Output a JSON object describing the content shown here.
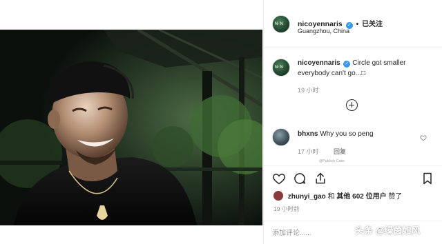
{
  "post": {
    "image_description_icon": "photo-icon"
  },
  "header": {
    "username": "nicoyennaris",
    "verified_icon": "verified-badge-icon",
    "dot": "•",
    "follow_status": "已关注",
    "location": "Guangzhou, China"
  },
  "caption": {
    "username": "nicoyennaris",
    "text": "Circle got smaller everybody can't go...",
    "glyph": "□",
    "time": "19 小时"
  },
  "load_more_icon": "plus-circle-icon",
  "comments": [
    {
      "username": "bhxns",
      "text": "Why you so peng",
      "time": "17 小时",
      "reply_label": "回复"
    }
  ],
  "tiny_watermark": "@Publish Cake",
  "actions": {
    "like_icon": "heart-icon",
    "comment_icon": "comment-icon",
    "share_icon": "share-icon",
    "save_icon": "bookmark-icon"
  },
  "likes": {
    "liker": "zhunyi_gao",
    "conj": "和",
    "others_prefix": "其他",
    "count": "602",
    "others_suffix": "位用户",
    "liked": "赞了"
  },
  "post_time": "19 小时前",
  "add_comment": {
    "placeholder": "添加评论......"
  },
  "watermark": "头条 @绿茵如风",
  "colors": {
    "accent": "#3897f0",
    "text": "#262626",
    "muted": "#8e8e8e",
    "border": "#efefef"
  }
}
